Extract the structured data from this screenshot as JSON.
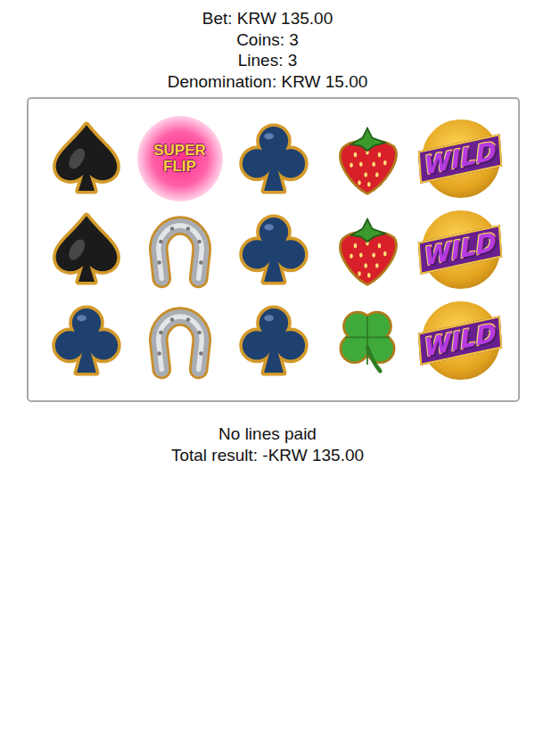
{
  "header": {
    "bet": "Bet: KRW 135.00",
    "coins": "Coins: 3",
    "lines": "Lines: 3",
    "denomination": "Denomination: KRW 15.00"
  },
  "reels": {
    "rows": [
      [
        {
          "kind": "spade"
        },
        {
          "kind": "superflip",
          "label": "SUPER FLIP"
        },
        {
          "kind": "club"
        },
        {
          "kind": "strawberry"
        },
        {
          "kind": "wild",
          "label": "WILD"
        }
      ],
      [
        {
          "kind": "spade"
        },
        {
          "kind": "horseshoe"
        },
        {
          "kind": "club"
        },
        {
          "kind": "strawberry"
        },
        {
          "kind": "wild",
          "label": "WILD"
        }
      ],
      [
        {
          "kind": "club"
        },
        {
          "kind": "horseshoe"
        },
        {
          "kind": "club"
        },
        {
          "kind": "clover"
        },
        {
          "kind": "wild",
          "label": "WILD"
        }
      ]
    ]
  },
  "result": {
    "message": "No lines paid",
    "total": "Total result: -KRW 135.00"
  }
}
